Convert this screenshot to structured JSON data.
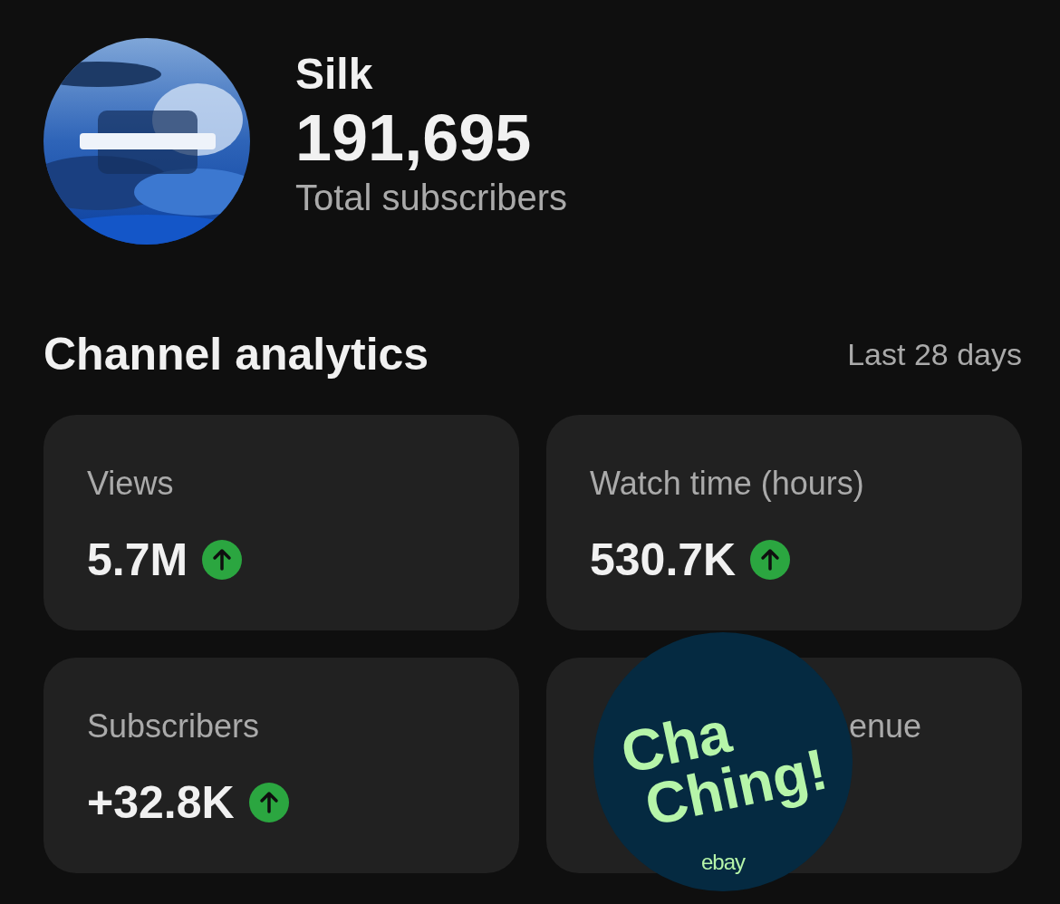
{
  "channel": {
    "name": "Silk",
    "subscriber_count": "191,695",
    "subscriber_label": "Total subscribers"
  },
  "analytics": {
    "title": "Channel analytics",
    "period": "Last 28 days",
    "cards": [
      {
        "kind": "metric",
        "title": "Views",
        "value": "5.7M",
        "rising": true
      },
      {
        "kind": "metric",
        "title": "Watch time (hours)",
        "value": "530.7K",
        "rising": true
      },
      {
        "kind": "metric",
        "title": "Subscribers",
        "value": "+32.8K",
        "rising": true
      },
      {
        "kind": "covered",
        "title_end": "enue"
      }
    ]
  },
  "sticker": {
    "line_1": "Cha",
    "line_2": "Ching!",
    "brand": "ebay"
  }
}
